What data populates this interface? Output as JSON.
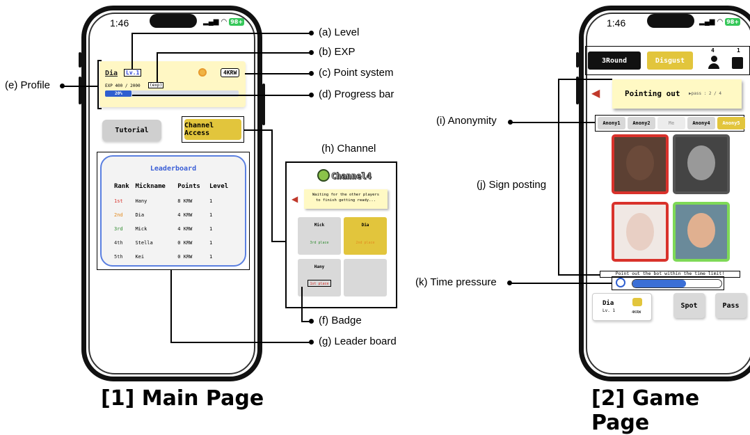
{
  "main_phone": {
    "status_time": "1:46",
    "battery": "98+",
    "profile": {
      "name": "Dia",
      "level": "Lv.1",
      "exp_text": "EXP 400 / 2000",
      "exp_tag": "(exp)",
      "points": "4KRW",
      "progress_label": "20%",
      "progress_fraction": 0.2
    },
    "tutorial_label": "Tutorial",
    "channel_access_label": "Channel Access",
    "leaderboard": {
      "title": "Leaderboard",
      "headers": [
        "Rank",
        "Mickname",
        "Points",
        "Level"
      ],
      "rows": [
        {
          "rank": "1st",
          "name": "Hany",
          "points": "8 KRW",
          "level": "1",
          "color": "#d9322b"
        },
        {
          "rank": "2nd",
          "name": "Dia",
          "points": "4 KRW",
          "level": "1",
          "color": "#e28a1f"
        },
        {
          "rank": "3rd",
          "name": "Mick",
          "points": "4 KRW",
          "level": "1",
          "color": "#2f8a2f"
        },
        {
          "rank": "4th",
          "name": "Stella",
          "points": "0 KRW",
          "level": "1",
          "color": "#222222"
        },
        {
          "rank": "5th",
          "name": "Kei",
          "points": "0 KRW",
          "level": "1",
          "color": "#222222"
        }
      ]
    }
  },
  "channel": {
    "title": "Channel4",
    "message": "Waiting for the other players to finish getting ready...",
    "players": [
      {
        "name": "Mick",
        "status": "3rd place"
      },
      {
        "name": "Dia",
        "status": "2nd place"
      },
      {
        "name": "Hany",
        "status": "1st place"
      }
    ]
  },
  "game_phone": {
    "status_time": "1:46",
    "battery": "98+",
    "round_label": "3Round",
    "emotion_label": "Disgust",
    "human_count": "4",
    "bot_count": "1",
    "pointing_label": "Pointing out",
    "pass_label": "pass : 2 / 4",
    "anony": [
      "Anony1",
      "Anony2",
      "Me",
      "Anony4",
      "Anony5"
    ],
    "time_text": "Point out the bot within the time limit!",
    "time_fraction": 0.6,
    "profile_name": "Dia",
    "profile_level": "Lv. 1",
    "profile_points": "4KRW",
    "spot_label": "Spot",
    "pass_button": "Pass"
  },
  "annotations": {
    "a": "(a) Level",
    "b": "(b) EXP",
    "c": "(c) Point system",
    "d": "(d) Progress bar",
    "e": "(e) Profile",
    "f": "(f) Badge",
    "g": "(g) Leader board",
    "h": "(h) Channel",
    "i": "(i) Anonymity",
    "j": "(j) Sign posting",
    "k": "(k) Time pressure"
  },
  "captions": {
    "main": "[1] Main Page",
    "game": "[2] Game Page"
  }
}
